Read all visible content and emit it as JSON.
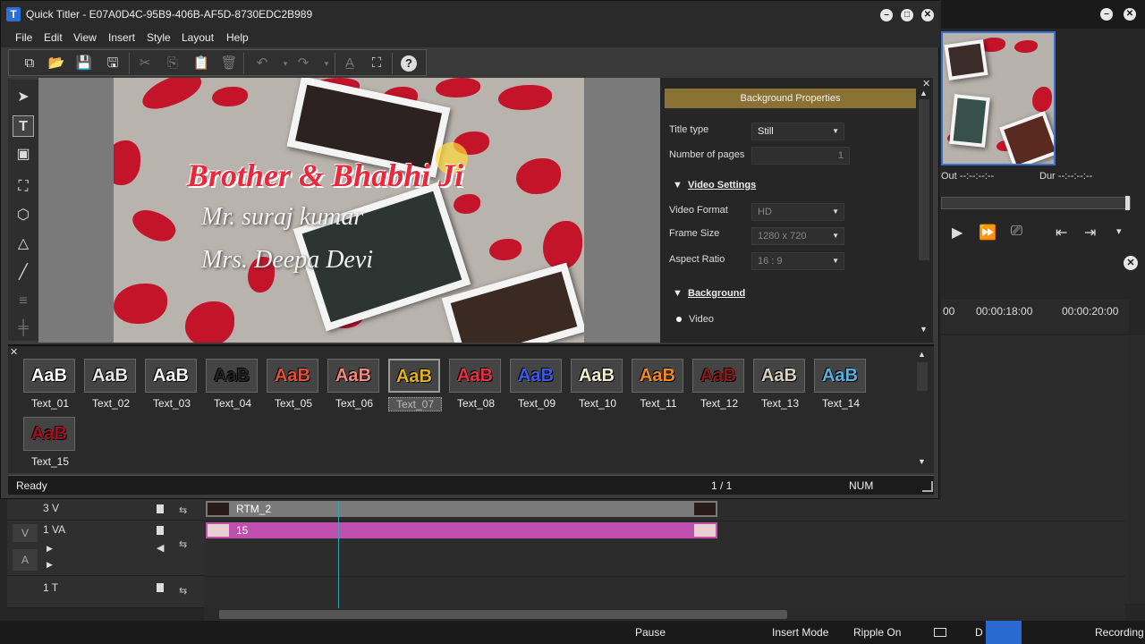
{
  "titler": {
    "title": "Quick Titler - E07A0D4C-95B9-406B-AF5D-8730EDC2B989",
    "menu": [
      "File",
      "Edit",
      "View",
      "Insert",
      "Style",
      "Layout",
      "Help"
    ],
    "canvas": {
      "line1": "Brother & Bhabhi Ji",
      "line2": "Mr. suraj kumar",
      "line3": "Mrs. Deepa Devi"
    },
    "properties": {
      "header": "Background Properties",
      "title_type_label": "Title type",
      "title_type_value": "Still",
      "pages_label": "Number of pages",
      "pages_value": "1",
      "video_settings": "Video Settings",
      "video_format_label": "Video Format",
      "video_format_value": "HD",
      "frame_size_label": "Frame Size",
      "frame_size_value": "1280 x 720",
      "aspect_ratio_label": "Aspect Ratio",
      "aspect_ratio_value": "16 : 9",
      "background": "Background",
      "bg_video": "Video"
    },
    "styles": [
      {
        "label": "Text_01",
        "sample": "AaB",
        "color": "#ffffff"
      },
      {
        "label": "Text_02",
        "sample": "AaB",
        "color": "#e8e8e8"
      },
      {
        "label": "Text_03",
        "sample": "AaB",
        "color": "#f4f4f4"
      },
      {
        "label": "Text_04",
        "sample": "AaB",
        "color": "#222222"
      },
      {
        "label": "Text_05",
        "sample": "AaB",
        "color": "#e0503a"
      },
      {
        "label": "Text_06",
        "sample": "AaB",
        "color": "#f08a80"
      },
      {
        "label": "Text_07",
        "sample": "AaB",
        "color": "#e2b020"
      },
      {
        "label": "Text_08",
        "sample": "AaB",
        "color": "#e83040"
      },
      {
        "label": "Text_09",
        "sample": "AaB",
        "color": "#3a5ae8"
      },
      {
        "label": "Text_10",
        "sample": "AaB",
        "color": "#f0f0d0"
      },
      {
        "label": "Text_11",
        "sample": "AaB",
        "color": "#f08a20"
      },
      {
        "label": "Text_12",
        "sample": "AaB",
        "color": "#8a1a1a"
      },
      {
        "label": "Text_13",
        "sample": "AaB",
        "color": "#d8d0c0"
      },
      {
        "label": "Text_14",
        "sample": "AaB",
        "color": "#5ab0e0"
      },
      {
        "label": "Text_15",
        "sample": "AaB",
        "color": "#a01020"
      }
    ],
    "status": {
      "left": "Ready",
      "pages": "1 / 1",
      "num": "NUM"
    }
  },
  "editor": {
    "timecode_out": "Out --:--:--:--",
    "timecode_dur": "Dur --:--:--:--",
    "ruler": [
      "00",
      "00:00:18:00",
      "00:00:20:00"
    ],
    "tracks": [
      {
        "name": "3 V",
        "clip": "RTM_2"
      },
      {
        "name": "1 VA",
        "clip": "15"
      },
      {
        "name": "1 T",
        "clip": ""
      }
    ],
    "track_side_labels": {
      "v": "V",
      "a": "A"
    },
    "status": {
      "pause": "Pause",
      "insert": "Insert Mode",
      "ripple": "Ripple On",
      "recording": "Recording",
      "d": "D"
    }
  },
  "colors": {
    "accent_header": "#8a7235",
    "clip_text": "#c050b0",
    "clip_video": "#7a7a7a",
    "title_red": "#e8283c"
  }
}
